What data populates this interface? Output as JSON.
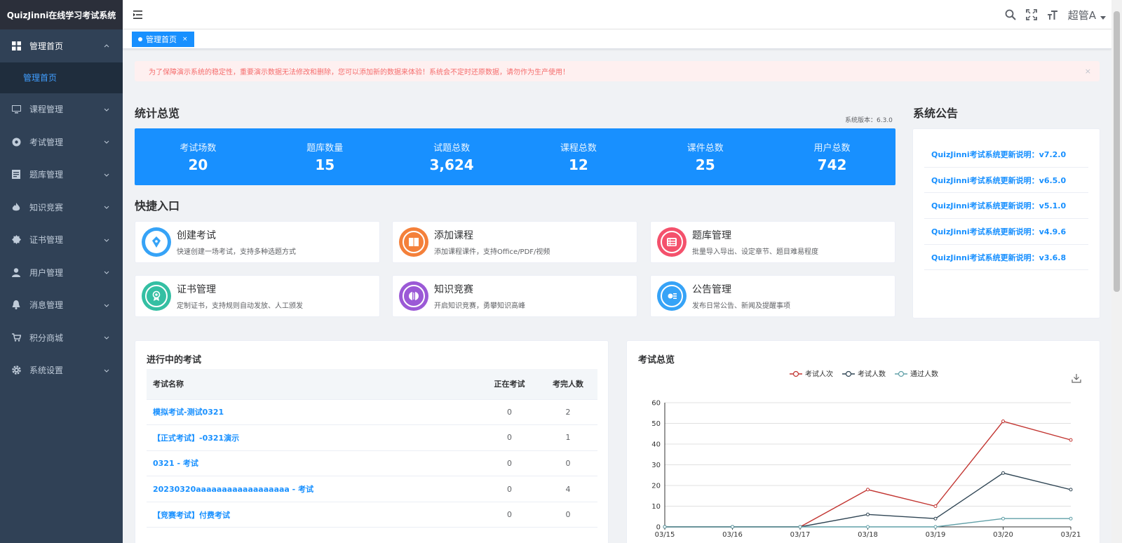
{
  "app": {
    "title": "QuizJinni在线学习考试系统"
  },
  "sidebar": {
    "items": [
      {
        "label": "管理首页",
        "icon": "dashboard-icon",
        "expanded": true
      },
      {
        "label": "课程管理",
        "icon": "monitor-icon"
      },
      {
        "label": "考试管理",
        "icon": "exam-icon"
      },
      {
        "label": "题库管理",
        "icon": "document-icon"
      },
      {
        "label": "知识竞赛",
        "icon": "fire-icon"
      },
      {
        "label": "证书管理",
        "icon": "badge-icon"
      },
      {
        "label": "用户管理",
        "icon": "user-icon"
      },
      {
        "label": "消息管理",
        "icon": "bell-icon"
      },
      {
        "label": "积分商城",
        "icon": "cart-icon"
      },
      {
        "label": "系统设置",
        "icon": "gear-icon"
      }
    ],
    "submenu": {
      "label": "管理首页"
    }
  },
  "header": {
    "user": "超管A"
  },
  "tags": {
    "active": "管理首页",
    "close": "×"
  },
  "alert": {
    "text": "为了保障演示系统的稳定性，重要演示数据无法修改和删除，您可以添加新的数据来体验！系统会不定时还原数据，请勿作为生产使用！",
    "close": "×"
  },
  "stats": {
    "title": "统计总览",
    "version": "系统版本：6.3.0",
    "items": [
      {
        "label": "考试场数",
        "value": "20"
      },
      {
        "label": "题库数量",
        "value": "15"
      },
      {
        "label": "试题总数",
        "value": "3,624"
      },
      {
        "label": "课程总数",
        "value": "12"
      },
      {
        "label": "课件总数",
        "value": "25"
      },
      {
        "label": "用户总数",
        "value": "742"
      }
    ]
  },
  "quick": {
    "title": "快捷入口",
    "items": [
      {
        "title": "创建考试",
        "desc": "快速创建一场考试，支持多种选题方式",
        "color": "#36a3f7",
        "icon": "pen-icon"
      },
      {
        "title": "添加课程",
        "desc": "添加课程课件，支持Office/PDF/视频",
        "color": "#f4803a",
        "icon": "book-icon"
      },
      {
        "title": "题库管理",
        "desc": "批量导入导出、设定章节、题目难易程度",
        "color": "#f4516c",
        "icon": "list-icon"
      },
      {
        "title": "证书管理",
        "desc": "定制证书，支持规则自动发放、人工颁发",
        "color": "#34bfa3",
        "icon": "award-icon"
      },
      {
        "title": "知识竞赛",
        "desc": "开启知识竞赛，勇攀知识高峰",
        "color": "#9b59d6",
        "icon": "versus-icon"
      },
      {
        "title": "公告管理",
        "desc": "发布日常公告、新闻及提醒事项",
        "color": "#36a3f7",
        "icon": "notice-icon"
      }
    ]
  },
  "notice": {
    "title": "系统公告",
    "items": [
      "QuizJinni考试系统更新说明：v7.2.0",
      "QuizJinni考试系统更新说明：v6.5.0",
      "QuizJinni考试系统更新说明：v5.1.0",
      "QuizJinni考试系统更新说明：v4.9.6",
      "QuizJinni考试系统更新说明：v3.6.8"
    ]
  },
  "exams": {
    "title": "进行中的考试",
    "columns": [
      "考试名称",
      "正在考试",
      "考完人数"
    ],
    "rows": [
      [
        "模拟考试-测试0321",
        "0",
        "2"
      ],
      [
        "【正式考试】-0321演示",
        "0",
        "1"
      ],
      [
        "0321 - 考试",
        "0",
        "0"
      ],
      [
        "20230320aaaaaaaaaaaaaaaaaa - 考试",
        "0",
        "4"
      ],
      [
        "【竞赛考试】付费考试",
        "0",
        "0"
      ]
    ]
  },
  "chart_panel": {
    "title": "考试总览"
  },
  "chart_data": {
    "type": "line",
    "title": "考试总览",
    "categories": [
      "03/15",
      "03/16",
      "03/17",
      "03/18",
      "03/19",
      "03/20",
      "03/21"
    ],
    "ylim": [
      0,
      60
    ],
    "yticks": [
      "0",
      "10",
      "20",
      "30",
      "40",
      "50",
      "60"
    ],
    "legend_position": "top-center",
    "series": [
      {
        "name": "考试人次",
        "color": "#c23531",
        "values": [
          0,
          0,
          0,
          18,
          10,
          51,
          42
        ]
      },
      {
        "name": "考试人数",
        "color": "#2f4554",
        "values": [
          0,
          0,
          0,
          6,
          4,
          26,
          18
        ]
      },
      {
        "name": "通过人数",
        "color": "#61a0a8",
        "values": [
          0,
          0,
          0,
          0,
          0,
          4,
          4
        ]
      }
    ]
  }
}
